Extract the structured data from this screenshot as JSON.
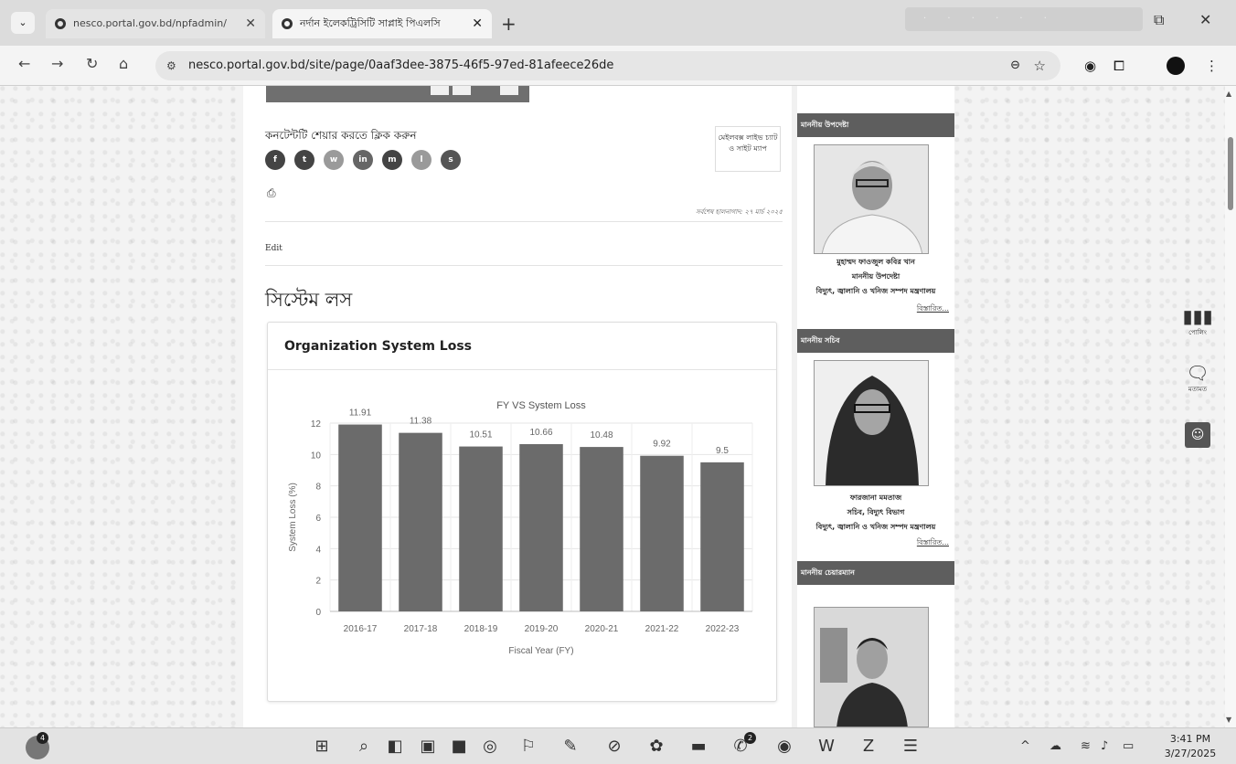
{
  "browser": {
    "tabs": [
      {
        "title": "nesco.portal.gov.bd/npfadmin/"
      },
      {
        "title": "নর্দান ইলেকট্রিসিটি সাপ্লাই পিএলসি"
      }
    ],
    "url": "nesco.portal.gov.bd/site/page/0aaf3dee-3875-46f5-97ed-81afeece26de"
  },
  "page": {
    "share_title": "কনটেন্টটি শেয়ার করতে ক্লিক করুন",
    "share_buttons": [
      "f",
      "t",
      "w",
      "in",
      "m",
      "l",
      "s"
    ],
    "side_box_text": "মেইলবক্স লাইভ চ্যাট ও সাইট ম্যাপ",
    "last_updated": "সর্বশেষ হালনাগাদ: ২৭ মার্চ ২০২৫",
    "edit_label": "Edit",
    "heading": "সিস্টেম লস",
    "card_title": "Organization System Loss"
  },
  "chart_data": {
    "type": "bar",
    "title": "FY VS System Loss",
    "xlabel": "Fiscal Year (FY)",
    "ylabel": "System Loss (%)",
    "categories": [
      "2016-17",
      "2017-18",
      "2018-19",
      "2019-20",
      "2020-21",
      "2021-22",
      "2022-23"
    ],
    "values": [
      11.91,
      11.38,
      10.51,
      10.66,
      10.48,
      9.92,
      9.5
    ],
    "data_labels": [
      "11.91",
      "11.38",
      "10.51",
      "10.66",
      "10.48",
      "9.92",
      "9.5"
    ],
    "ylim": [
      0,
      12
    ],
    "yticks": [
      0,
      2,
      4,
      6,
      8,
      10,
      12
    ],
    "grid": true,
    "bar_color": "#6b6b6b"
  },
  "sidebar": {
    "sections": [
      {
        "heading": "মাননীয় উপদেষ্টা",
        "name": "মুহাম্মদ ফাওজুল কবির খান",
        "line2": "মাননীয় উপদেষ্টা",
        "line3": "বিদ্যুৎ, জ্বালানি ও খনিজ সম্পদ মন্ত্রণালয়",
        "more": "বিস্তারিত..."
      },
      {
        "heading": "মাননীয় সচিব",
        "name": "ফারজানা মমতাজ",
        "line2": "সচিব, বিদ্যুৎ বিভাগ",
        "line3": "বিদ্যুৎ, জ্বালানি ও খনিজ সম্পদ মন্ত্রণালয়",
        "more": "বিস্তারিত..."
      },
      {
        "heading": "মাননীয় চেয়ারম্যান"
      }
    ]
  },
  "float_tools": {
    "poll_label": "পোলিং",
    "feedback_label": "মতামত"
  },
  "taskbar": {
    "weather_badge": "4",
    "whatsapp_badge": "2",
    "time": "3:41 PM",
    "date": "3/27/2025"
  }
}
